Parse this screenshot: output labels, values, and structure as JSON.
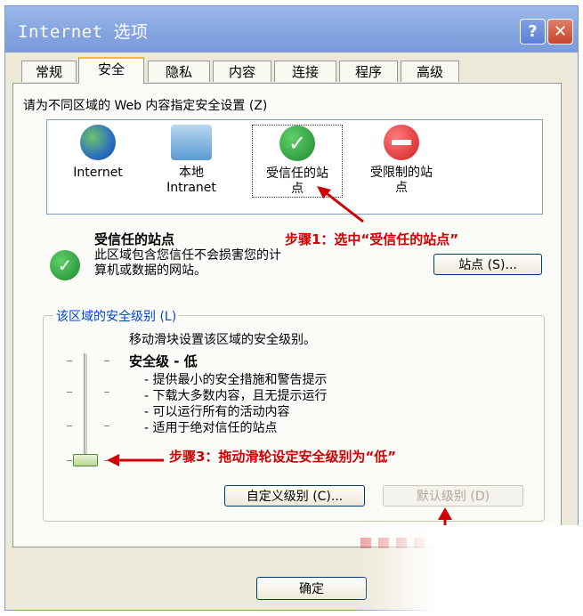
{
  "window": {
    "title": "Internet 选项",
    "help_label": "?",
    "close_label": "✕"
  },
  "tabs": [
    {
      "label": "常规"
    },
    {
      "label": "安全"
    },
    {
      "label": "隐私"
    },
    {
      "label": "内容"
    },
    {
      "label": "连接"
    },
    {
      "label": "程序"
    },
    {
      "label": "高级"
    }
  ],
  "security": {
    "instruction": "请为不同区域的 Web 内容指定安全设置 (Z)",
    "zones": [
      {
        "label": "Internet",
        "icon": "globe-icon"
      },
      {
        "label": "本地\nIntranet",
        "icon": "computer-icon"
      },
      {
        "label": "受信任的站\n点",
        "icon": "check-icon"
      },
      {
        "label": "受限制的站\n点",
        "icon": "stop-icon"
      }
    ],
    "selected_zone": {
      "title": "受信任的站点",
      "description": "此区域包含您信任不会损害您的计\n算机或数据的网站。",
      "sites_button": "站点 (S)..."
    },
    "level_group": {
      "legend": "该区域的安全级别 (L)",
      "hint": "移动滑块设置该区域的安全级别。",
      "level_title": "安全级 - 低",
      "bullets": [
        "- 提供最小的安全措施和警告提示",
        "- 下载大多数内容，且无提示运行",
        "- 可以运行所有的活动内容",
        "- 适用于绝对信任的站点"
      ],
      "slider_level": "低",
      "custom_button": "自定义级别 (C)...",
      "default_button": "默认级别 (D)"
    }
  },
  "annotations": {
    "step1": "步骤1：选中“受信任的站点”",
    "step3": "步骤3：拖动滑轮设定安全级别为“低”"
  },
  "footer": {
    "ok_button": "确定"
  },
  "colors": {
    "annotation": "#d00000",
    "titlebar": "#86a6e0",
    "legend": "#0046d5"
  }
}
